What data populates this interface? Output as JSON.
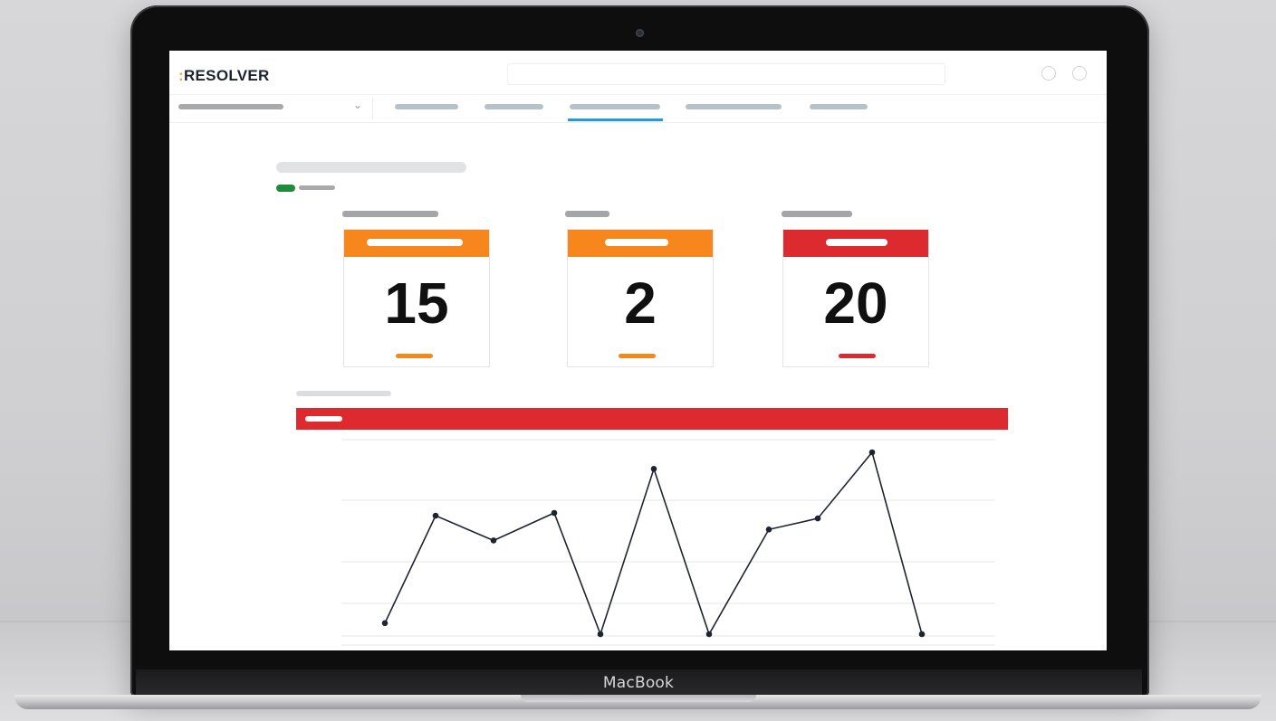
{
  "device": {
    "brand_label": "MacBook"
  },
  "app": {
    "logo_prefix": ":",
    "logo_text": "RESOLVER",
    "header_icons": [
      "circle-icon",
      "circle-icon"
    ]
  },
  "nav": {
    "tabs_count": 5,
    "active_tab_index": 2
  },
  "status": {
    "color": "#1f8a3a"
  },
  "cards": [
    {
      "value": "15",
      "color": "#f7861d"
    },
    {
      "value": "2",
      "color": "#f7861d"
    },
    {
      "value": "20",
      "color": "#dc2a2f"
    }
  ],
  "section": {
    "bar_color": "#dc2a2f"
  },
  "chart_data": {
    "type": "line",
    "title": "",
    "xlabel": "",
    "ylabel": "",
    "x": [
      1,
      2,
      3,
      4,
      5,
      6,
      7,
      8,
      9,
      10,
      11
    ],
    "series": [
      {
        "values": [
          0.2,
          2.15,
          1.7,
          2.2,
          0,
          3.0,
          0,
          1.9,
          2.1,
          3.3,
          0
        ]
      }
    ],
    "ylim": [
      0,
      3.3
    ],
    "grid": true,
    "legend": "none",
    "line_color": "#1d2430"
  }
}
